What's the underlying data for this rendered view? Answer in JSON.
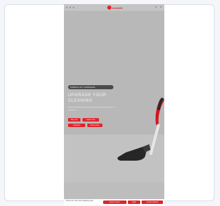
{
  "brand": {
    "name": "vorwerk",
    "accent": "#e2232a"
  },
  "hero": {
    "badge": "KOBOLD VK7 CORDLESS",
    "headline": "UPGRADE YOUR CLEANING",
    "subtext": "Powerful cordless cleaning for every floor and every corner of your home."
  },
  "buttons": {
    "primary": "Buy now",
    "secondary": "Learn more",
    "tertiary": "Compare",
    "quaternary": "Find a store"
  },
  "bottombar": {
    "legal": "Prices incl. VAT, plus shipping costs",
    "cta1": "Book a demo",
    "cta2": "Shop",
    "cta3": "Contact advisor"
  },
  "icons": {
    "logo": "logo-mark",
    "status": "status-dot"
  }
}
